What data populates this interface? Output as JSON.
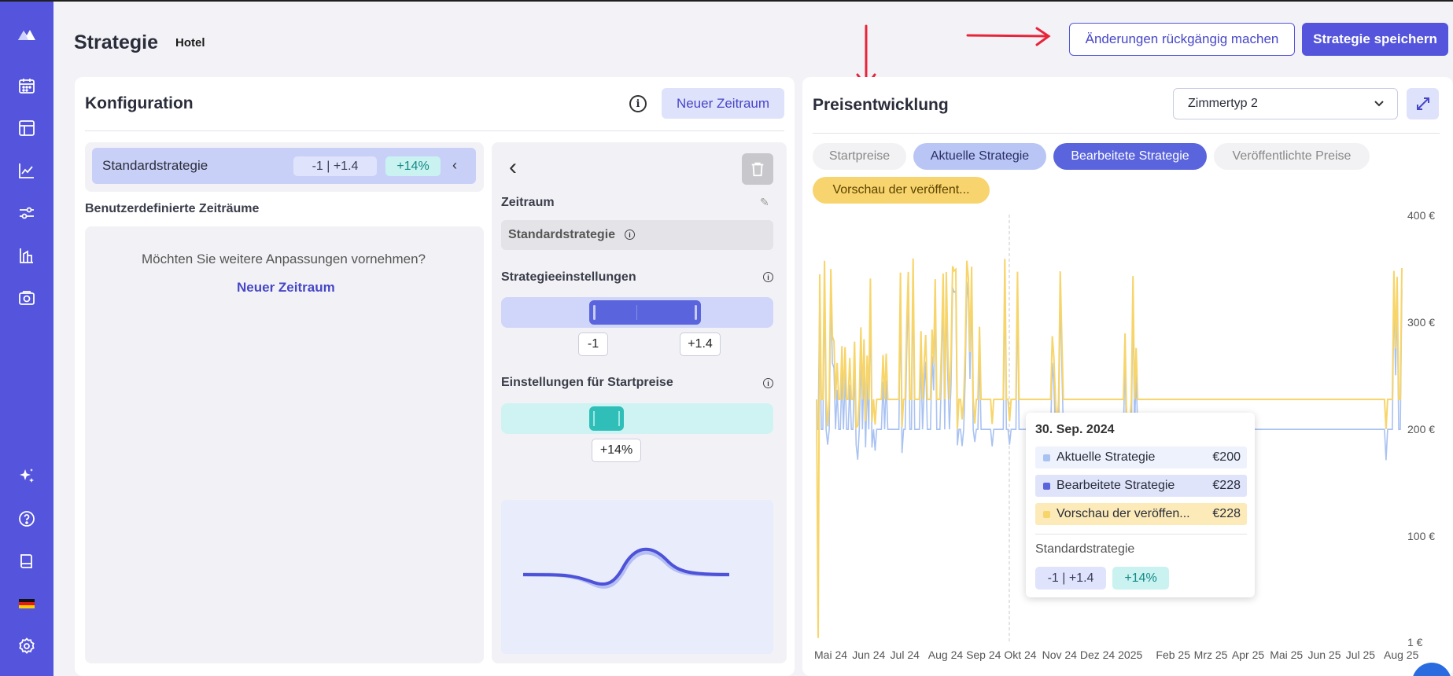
{
  "header": {
    "title": "Strategie",
    "subtitle": "Hotel",
    "undo_label": "Änderungen rückgängig machen",
    "save_label": "Strategie speichern"
  },
  "config": {
    "title": "Konfiguration",
    "new_period_label": "Neuer Zeitraum",
    "default_strategy": {
      "label": "Standardstrategie",
      "range": "-1 | +1.4",
      "start": "+14%"
    },
    "custom_heading": "Benutzerdefinierte Zeiträume",
    "empty_text": "Möchten Sie weitere Anpassungen vornehmen?",
    "empty_link": "Neuer Zeitraum"
  },
  "detail": {
    "period_label": "Zeitraum",
    "period_value": "Standardstrategie",
    "strategy_settings_label": "Strategieeinstellungen",
    "slider_min": "-1",
    "slider_max": "+1.4",
    "start_settings_label": "Einstellungen für Startpreise",
    "start_value": "+14%"
  },
  "chart_panel": {
    "title": "Preisentwicklung",
    "room_select": "Zimmertyp 2",
    "tabs": [
      "Startpreise",
      "Aktuelle Strategie",
      "Bearbeitete Strategie",
      "Veröffentlichte Preise",
      "Vorschau der veröffent..."
    ]
  },
  "tooltip": {
    "date": "30. Sep. 2024",
    "rows": [
      {
        "name": "Aktuelle Strategie",
        "value": "€200"
      },
      {
        "name": "Bearbeitete Strategie",
        "value": "€228"
      },
      {
        "name": "Vorschau der veröffen...",
        "value": "€228"
      }
    ],
    "strategy_label": "Standardstrategie",
    "range": "-1 | +1.4",
    "start": "+14%"
  },
  "colors": {
    "accent": "#5454dc",
    "current": "#a9c2f2",
    "edited": "#5a64dc",
    "preview": "#f7d56a",
    "teal": "#2fbfb8"
  },
  "chart_data": {
    "type": "line",
    "x": [
      "Mai 24",
      "Jun 24",
      "Jul 24",
      "Aug 24",
      "Sep 24",
      "Okt 24",
      "Nov 24",
      "Dez 24",
      "2025",
      "Feb 25",
      "Mrz 25",
      "Apr 25",
      "Mai 25",
      "Jun 25",
      "Jul 25",
      "Aug 25"
    ],
    "y_ticks": [
      "400 €",
      "300 €",
      "200 €",
      "100 €",
      "1 €"
    ],
    "ylim": [
      1,
      400
    ],
    "series": [
      {
        "name": "Aktuelle Strategie",
        "baseline": 200
      },
      {
        "name": "Vorschau der veröffentlichten Preise",
        "baseline": 228
      }
    ]
  }
}
